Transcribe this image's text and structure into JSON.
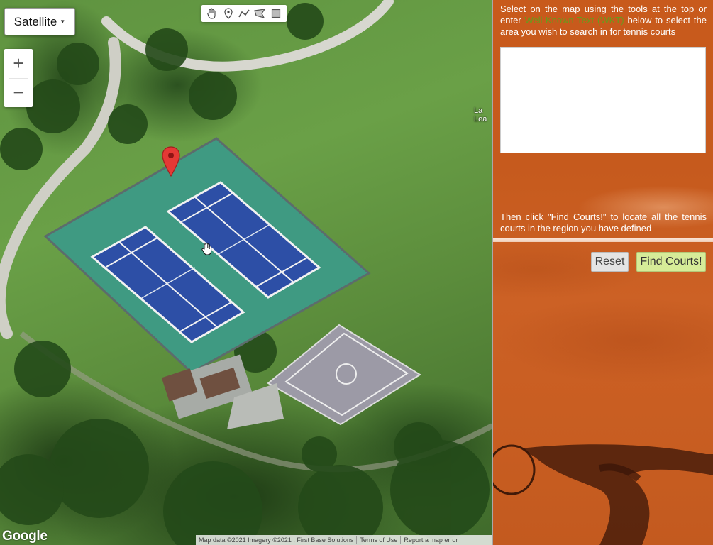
{
  "map": {
    "map_type_label": "Satellite",
    "zoom_in_label": "+",
    "zoom_out_label": "−",
    "poi_label": "La\nLea",
    "google_logo": "Google",
    "attribution": {
      "map_data": "Map data ©2021 Imagery ©2021 , First Base Solutions",
      "terms": "Terms of Use",
      "report": "Report a map error"
    },
    "drawing_tools": [
      "hand-icon",
      "marker-icon",
      "polyline-icon",
      "polygon-icon",
      "rectangle-icon"
    ]
  },
  "panel": {
    "instructions_part1": "Select on the map using the tools at the top or enter",
    "wkt_link": "Well-Known Text (WKT)",
    "instructions_part2": "below to select the area you wish to search in for tennis courts",
    "wkt_value": "",
    "then_text": "Then click \"Find Courts!\" to locate all the tennis courts in the region you have defined",
    "reset_label": "Reset",
    "find_label": "Find Courts!"
  },
  "colors": {
    "panel_clay": "#c85a1c",
    "find_button": "#d6ec98",
    "wkt_link": "#6a9a1c",
    "marker": "#e53935"
  }
}
